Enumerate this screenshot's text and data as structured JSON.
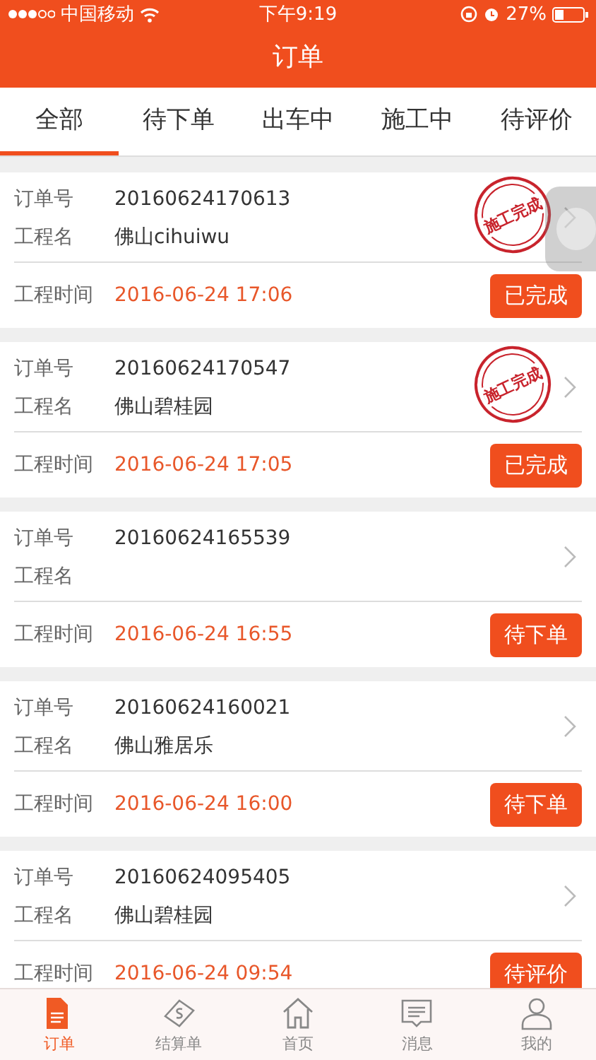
{
  "status_bar": {
    "carrier": "中国移动",
    "time": "下午9:19",
    "battery": "27%"
  },
  "nav": {
    "title": "订单"
  },
  "tabs": [
    {
      "label": "全部",
      "selected": true
    },
    {
      "label": "待下单",
      "selected": false
    },
    {
      "label": "出车中",
      "selected": false
    },
    {
      "label": "施工中",
      "selected": false
    },
    {
      "label": "待评价",
      "selected": false
    }
  ],
  "orders": [
    {
      "order_label": "订单号",
      "order_no": "20160624170613",
      "name_label": "工程名",
      "name": "佛山cihuiwu",
      "time_label": "工程时间",
      "time": "2016-06-24 17:06",
      "action": "已完成",
      "stamp": "施工完成"
    },
    {
      "order_label": "订单号",
      "order_no": "20160624170547",
      "name_label": "工程名",
      "name": "佛山碧桂园",
      "time_label": "工程时间",
      "time": "2016-06-24 17:05",
      "action": "已完成",
      "stamp": "施工完成"
    },
    {
      "order_label": "订单号",
      "order_no": "20160624165539",
      "name_label": "工程名",
      "time_label": "工程时间",
      "time": "2016-06-24 16:55",
      "action": "待下单"
    },
    {
      "order_label": "订单号",
      "order_no": "20160624160021",
      "name_label": "工程名",
      "name": "佛山雅居乐",
      "time_label": "工程时间",
      "time": "2016-06-24 16:00",
      "action": "待下单"
    },
    {
      "order_label": "订单号",
      "order_no": "20160624095405",
      "name_label": "工程名",
      "name": "佛山碧桂园",
      "time_label": "工程时间",
      "time": "2016-06-24 09:54",
      "action": "待评价"
    }
  ],
  "tab_bar": [
    {
      "label": "订单",
      "selected": true
    },
    {
      "label": "结算单",
      "selected": false
    },
    {
      "label": "首页",
      "selected": false
    },
    {
      "label": "消息",
      "selected": false
    },
    {
      "label": "我的",
      "selected": false
    }
  ]
}
